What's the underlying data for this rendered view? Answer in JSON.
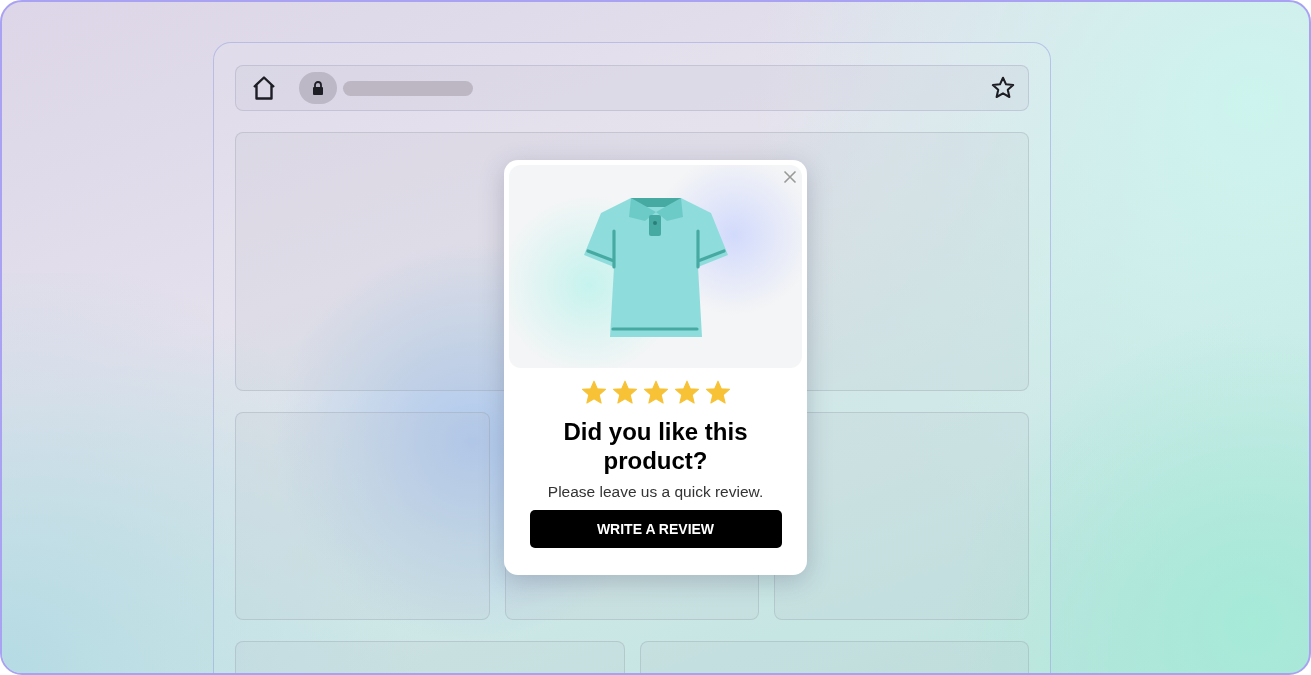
{
  "popup": {
    "stars": 5,
    "title": "Did you like this product?",
    "message": "Please leave us a quick review.",
    "button": "WRITE A REVIEW"
  }
}
